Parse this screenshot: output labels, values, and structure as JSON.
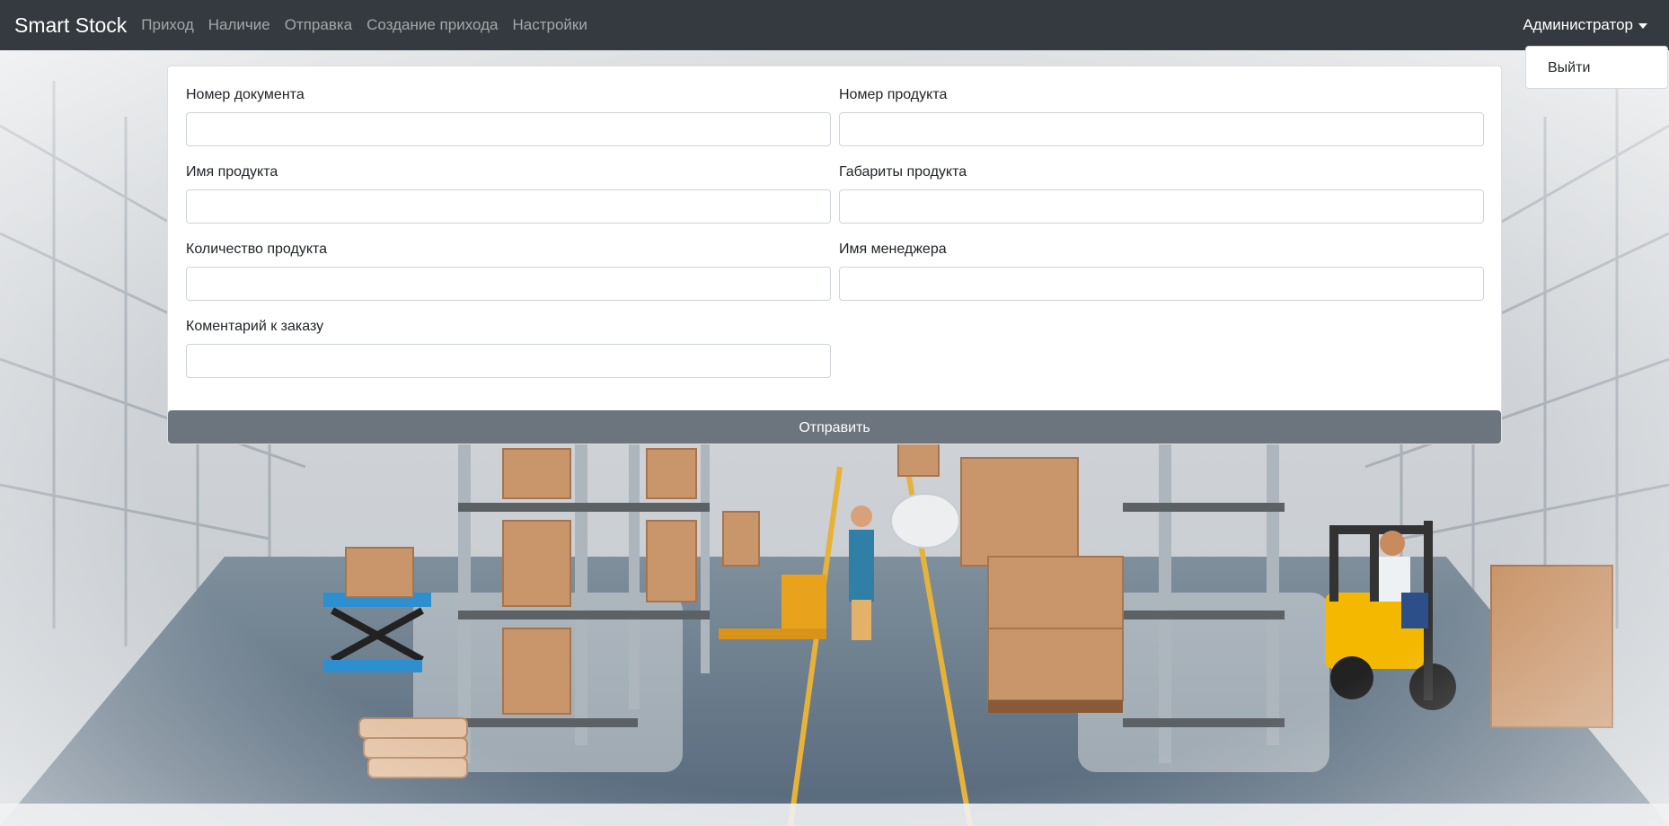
{
  "navbar": {
    "brand": "Smart Stock",
    "links": [
      "Приход",
      "Наличие",
      "Отправка",
      "Создание прихода",
      "Настройки"
    ],
    "user": "Администратор"
  },
  "user_menu": {
    "items": [
      "Выйти"
    ]
  },
  "form": {
    "fields": [
      {
        "label": "Номер документа",
        "value": ""
      },
      {
        "label": "Номер продукта",
        "value": ""
      },
      {
        "label": "Имя продукта",
        "value": ""
      },
      {
        "label": "Габариты продукта",
        "value": ""
      },
      {
        "label": "Количество продукта",
        "value": ""
      },
      {
        "label": "Имя менеджера",
        "value": ""
      },
      {
        "label": "Коментарий к заказу",
        "value": ""
      }
    ],
    "submit_label": "Отправить"
  },
  "colors": {
    "navbar": "#343a40",
    "submit_button": "#6c757d",
    "forklift": "#f5b800",
    "boxes": "#c9956a"
  }
}
